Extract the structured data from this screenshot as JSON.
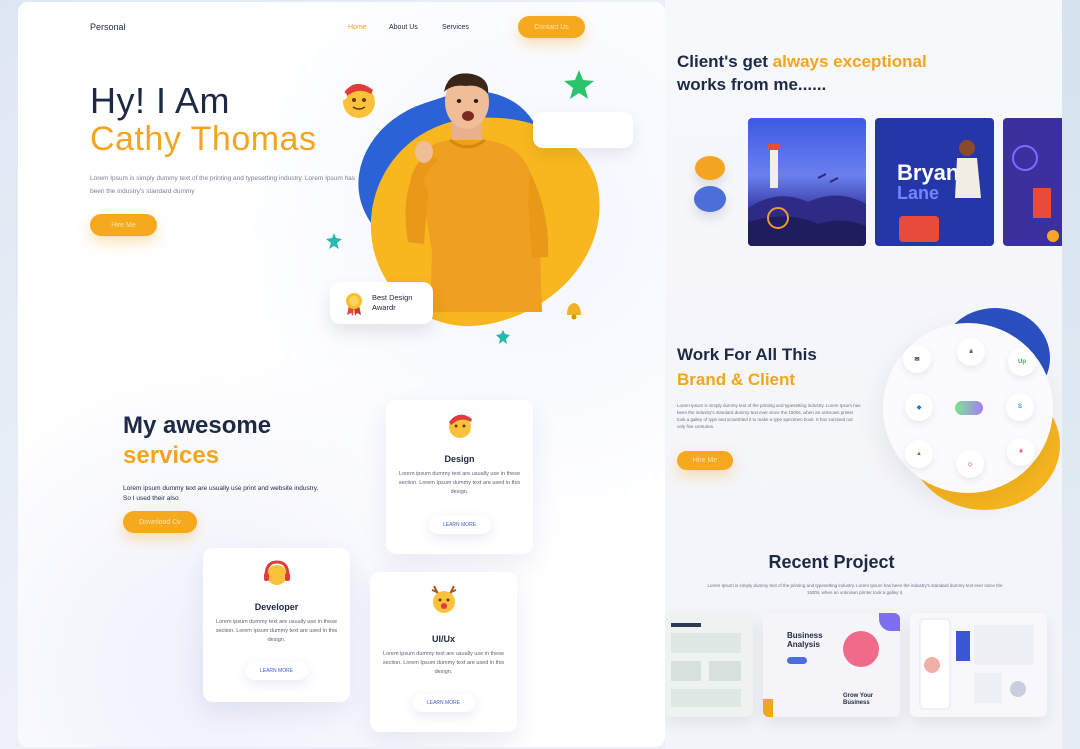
{
  "nav": {
    "brand": "Personal",
    "home": "Home",
    "about": "About Us",
    "services": "Services",
    "contact": "Contact Us"
  },
  "hero": {
    "greeting": "Hy! I Am",
    "name": "Cathy Thomas",
    "description": "Lorem Ipsum is simply dummy text of the printing and typesetting industry. Lorem Ipsum has been the industry's standard dummy",
    "cta": "Hire Me",
    "award": "Best Design Awardr"
  },
  "services": {
    "title_line1": "My awesome",
    "title_line2": "services",
    "description": "Lorem ipsum dummy text are usually use print and website industry. So I used their also",
    "cta": "Download Cv",
    "cards": [
      {
        "title": "Design",
        "text": "Lorem ipsum dummy text are usually use in these section. Lorem Ipsum dummy text are used in this design.",
        "link": "LEARN MORE"
      },
      {
        "title": "Developer",
        "text": "Lorem ipsum dummy text are usually use in these section. Lorem Ipsum dummy text are used in this design.",
        "link": "LEARN MORE"
      },
      {
        "title": "UI/Ux",
        "text": "Lorem ipsum dummy text are usually use in these section. Lorem Ipsum dummy text are used in this design.",
        "link": "LEARN MORE"
      }
    ]
  },
  "clients": {
    "title_prefix": "Client's get ",
    "title_highlight": "always exceptional",
    "title_line2": "works from me......",
    "thumb2_title": "Bryan",
    "thumb2_sub": "Lane"
  },
  "work": {
    "title_line1": "Work For All This",
    "title_line2": "Brand & Client",
    "description": "Lorem Ipsum is simply dummy text of the printing and typesetting industry. Lorem Ipsum has been the industry's standard dummy text ever since the 1500s, when an unknown printer took a galley of type and scrambled it to make a type specimen book. It has survived not only five centuries.",
    "cta": "Hire Me",
    "logos": [
      "mailchimp",
      "amazon",
      "upwork",
      "dropbox",
      "slack-pill",
      "skype",
      "shopify",
      "airbnb",
      "slack"
    ]
  },
  "recent": {
    "title": "Recent Project",
    "description": "Lorem Ipsum is simply dummy text of the printing and typesetting industry. Lorem Ipsum has been the industry's standard dummy text ever since the 1500s, when an unknown printer took a galley it.",
    "project2_title1": "Business",
    "project2_title2": "Analysis",
    "project2_footer1": "Grow Your",
    "project2_footer2": "Business"
  },
  "colors": {
    "accent": "#f3a51f",
    "dark": "#1e2a45",
    "blue": "#2b63d6"
  }
}
